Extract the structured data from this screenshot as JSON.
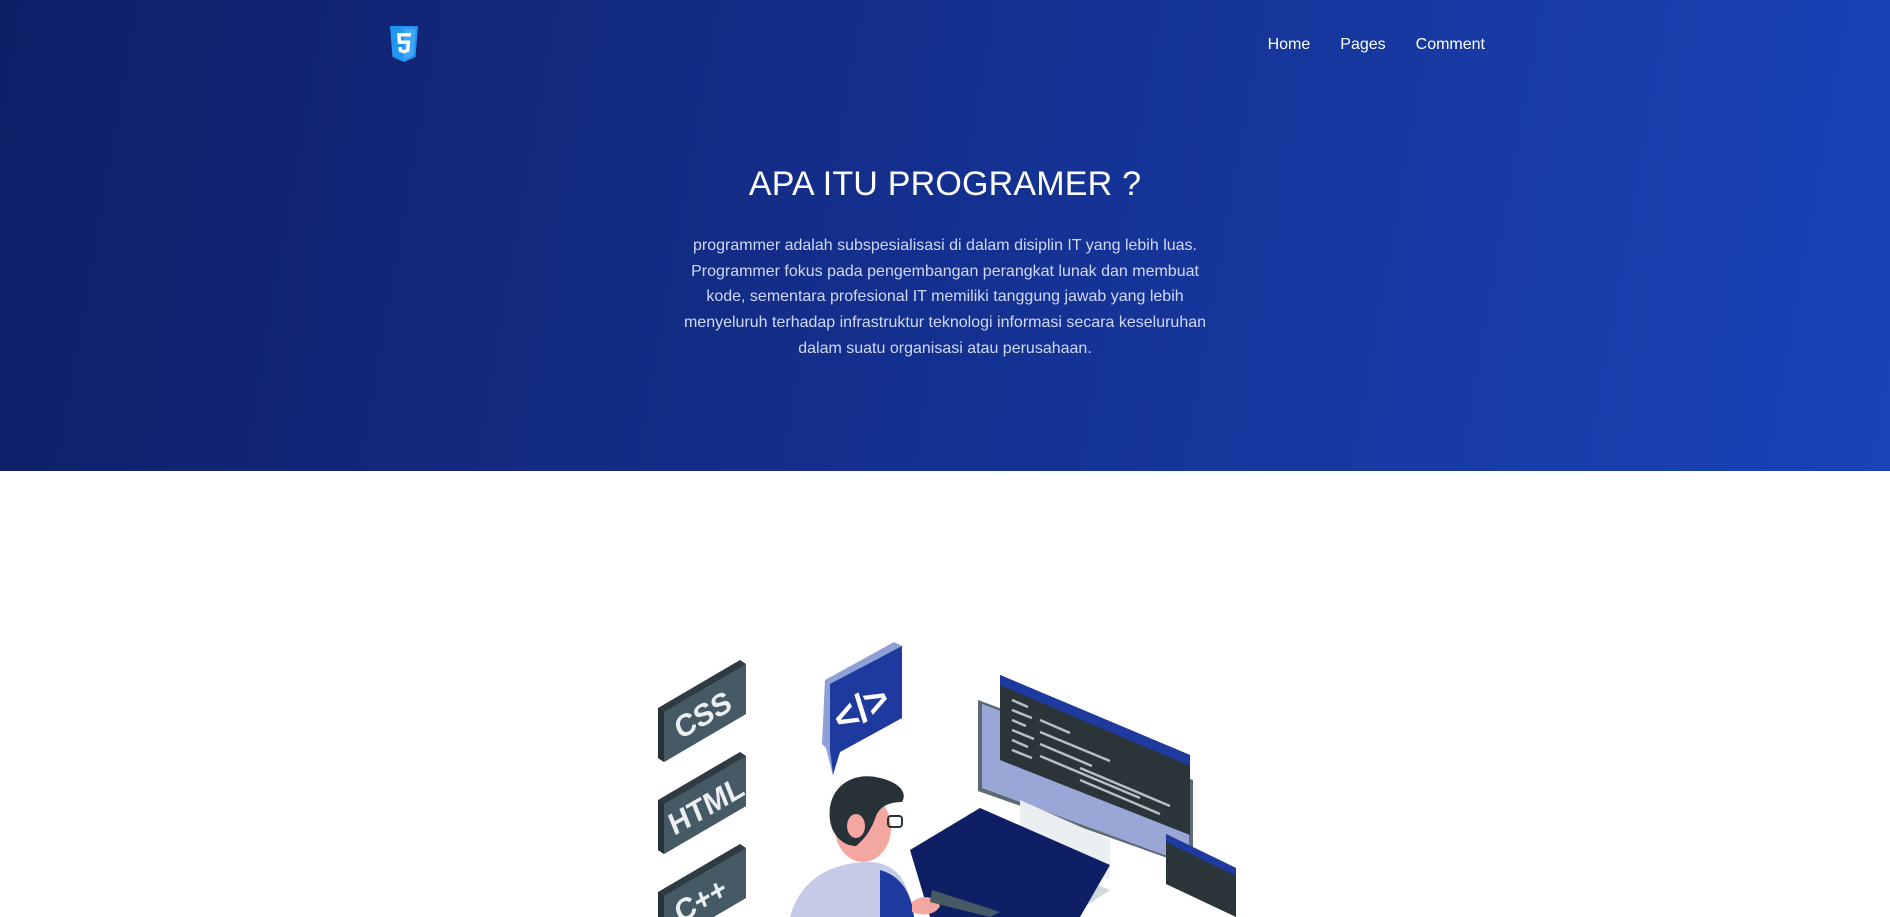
{
  "nav": {
    "logo_icon": "html5-shield-icon",
    "links": [
      "Home",
      "Pages",
      "Comment"
    ]
  },
  "hero": {
    "title": "APA ITU PROGRAMER ?",
    "description": "programmer adalah subspesialisasi di dalam disiplin IT yang lebih luas. Programmer fokus pada pengembangan perangkat lunak dan membuat kode, sementara profesional IT memiliki tanggung jawab yang lebih menyeluruh terhadap infrastruktur teknologi informasi secara keseluruhan dalam suatu organisasi atau perusahaan."
  },
  "illustration": {
    "badges": [
      "CSS",
      "HTML",
      "C++"
    ],
    "code_bubble": "</>"
  },
  "colors": {
    "hero_start": "#0f1f66",
    "hero_end": "#1a43b8",
    "logo": "#2196f3",
    "badge_dark": "#37474f"
  }
}
